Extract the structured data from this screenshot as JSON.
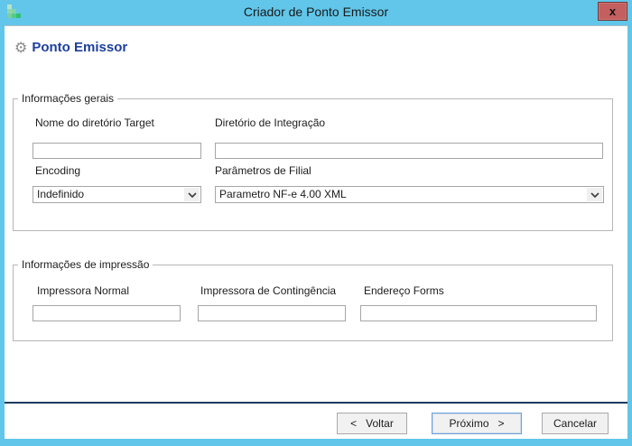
{
  "window": {
    "title": "Criador de Ponto Emissor",
    "close": "x"
  },
  "page": {
    "title": "Ponto Emissor"
  },
  "general": {
    "legend": "Informações gerais",
    "target_dir_label": "Nome do diretório Target",
    "target_dir_value": "",
    "integration_dir_label": "Diretório de Integração",
    "integration_dir_value": "",
    "encoding_label": "Encoding",
    "encoding_value": "Indefinido",
    "branch_params_label": "Parâmetros de Filial",
    "branch_params_value": "Parametro NF-e 4.00 XML"
  },
  "printing": {
    "legend": "Informações de impressão",
    "printer_normal_label": "Impressora Normal",
    "printer_normal_value": "",
    "printer_contingency_label": "Impressora de Contingência",
    "printer_contingency_value": "",
    "forms_address_label": "Endereço Forms",
    "forms_address_value": ""
  },
  "footer": {
    "back": "<   Voltar",
    "next": "Próximo   >",
    "cancel": "Cancelar"
  },
  "colors": {
    "titlebar_blue": "#61c6e9",
    "close_button_red": "#c35f5f",
    "heading_blue": "#1d3f9d",
    "separator_navy": "#1c3a60",
    "focus_border_blue": "#6da1d8"
  }
}
